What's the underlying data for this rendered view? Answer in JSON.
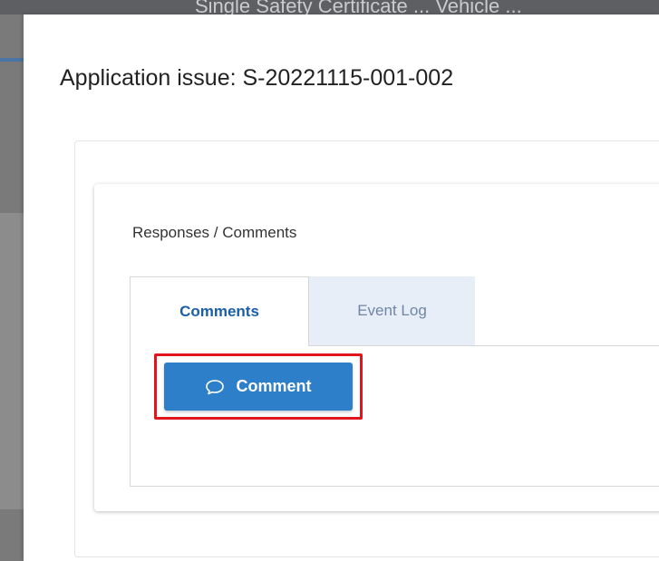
{
  "background": {
    "page_title_fragment": "Single Safety Certificate ... Vehicle ..."
  },
  "modal": {
    "title": "Application issue: S-20221115-001-002"
  },
  "responses_card": {
    "heading": "Responses / Comments",
    "tabs": [
      {
        "label": "Comments",
        "active": true
      },
      {
        "label": "Event Log",
        "active": false
      }
    ],
    "comment_button": {
      "label": "Comment",
      "icon": "speech-bubble-icon"
    }
  },
  "colors": {
    "primary_button": "#2c7fc8",
    "active_tab_text": "#1a5fa8",
    "inactive_tab_bg": "#e8eef7",
    "highlight": "#e0161c"
  }
}
